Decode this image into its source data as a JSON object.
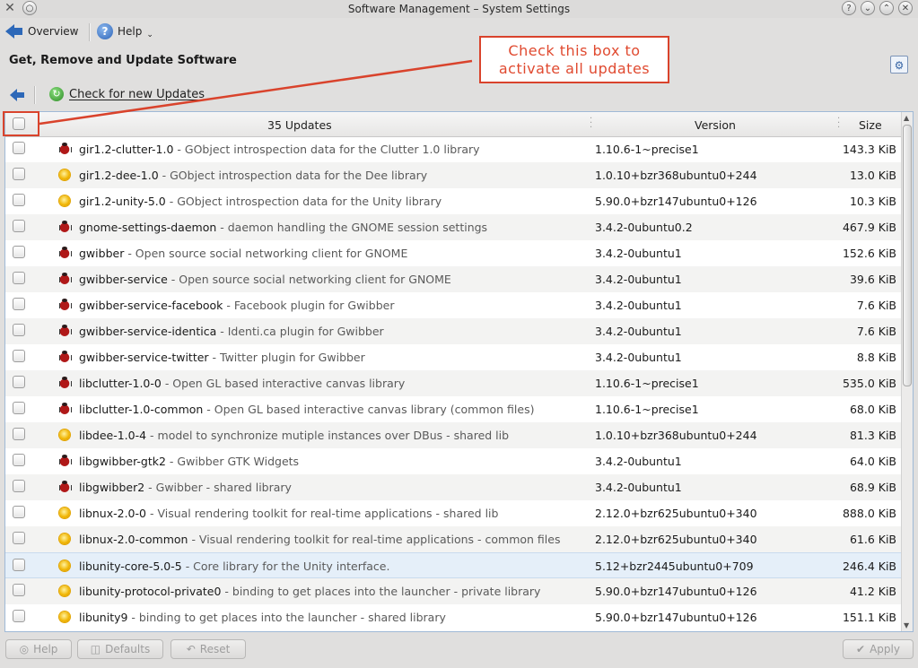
{
  "window": {
    "title": "Software Management – System Settings",
    "controls": [
      "?",
      "⌄",
      "⌃",
      "✕"
    ]
  },
  "toolbar": {
    "overview_label": "Overview",
    "help_label": "Help",
    "help_icon": "?"
  },
  "page": {
    "heading": "Get, Remove and Update Software",
    "check_updates_label": "Check for new Updates"
  },
  "annotation": {
    "text_line1": "Check this box to",
    "text_line2": "activate all updates",
    "color": "#d9432c"
  },
  "table": {
    "headers": {
      "updates": "35 Updates",
      "version": "Version",
      "size": "Size"
    },
    "rows": [
      {
        "icon": "bug",
        "name": "gir1.2-clutter-1.0",
        "desc": " - GObject introspection data for the Clutter 1.0 library",
        "version": "1.10.6-1~precise1",
        "size": "143.3 KiB"
      },
      {
        "icon": "sun",
        "name": "gir1.2-dee-1.0",
        "desc": " - GObject introspection data for the Dee library",
        "version": "1.0.10+bzr368ubuntu0+244",
        "size": "13.0 KiB"
      },
      {
        "icon": "sun",
        "name": "gir1.2-unity-5.0",
        "desc": " - GObject introspection data for the Unity library",
        "version": "5.90.0+bzr147ubuntu0+126",
        "size": "10.3 KiB"
      },
      {
        "icon": "bug",
        "name": "gnome-settings-daemon",
        "desc": " - daemon handling the GNOME session settings",
        "version": "3.4.2-0ubuntu0.2",
        "size": "467.9 KiB"
      },
      {
        "icon": "bug",
        "name": "gwibber",
        "desc": " - Open source social networking client for GNOME",
        "version": "3.4.2-0ubuntu1",
        "size": "152.6 KiB"
      },
      {
        "icon": "bug",
        "name": "gwibber-service",
        "desc": " - Open source social networking client for GNOME",
        "version": "3.4.2-0ubuntu1",
        "size": "39.6 KiB"
      },
      {
        "icon": "bug",
        "name": "gwibber-service-facebook",
        "desc": " - Facebook plugin for Gwibber",
        "version": "3.4.2-0ubuntu1",
        "size": "7.6 KiB"
      },
      {
        "icon": "bug",
        "name": "gwibber-service-identica",
        "desc": " - Identi.ca plugin for Gwibber",
        "version": "3.4.2-0ubuntu1",
        "size": "7.6 KiB"
      },
      {
        "icon": "bug",
        "name": "gwibber-service-twitter",
        "desc": " - Twitter plugin for Gwibber",
        "version": "3.4.2-0ubuntu1",
        "size": "8.8 KiB"
      },
      {
        "icon": "bug",
        "name": "libclutter-1.0-0",
        "desc": " - Open GL based interactive canvas library",
        "version": "1.10.6-1~precise1",
        "size": "535.0 KiB"
      },
      {
        "icon": "bug",
        "name": "libclutter-1.0-common",
        "desc": " - Open GL based interactive canvas library (common files)",
        "version": "1.10.6-1~precise1",
        "size": "68.0 KiB"
      },
      {
        "icon": "sun",
        "name": "libdee-1.0-4",
        "desc": " - model to synchronize mutiple instances over DBus - shared lib",
        "version": "1.0.10+bzr368ubuntu0+244",
        "size": "81.3 KiB"
      },
      {
        "icon": "bug",
        "name": "libgwibber-gtk2",
        "desc": " - Gwibber GTK Widgets",
        "version": "3.4.2-0ubuntu1",
        "size": "64.0 KiB"
      },
      {
        "icon": "bug",
        "name": "libgwibber2",
        "desc": " - Gwibber - shared library",
        "version": "3.4.2-0ubuntu1",
        "size": "68.9 KiB"
      },
      {
        "icon": "sun",
        "name": "libnux-2.0-0",
        "desc": " - Visual rendering toolkit for real-time applications - shared lib",
        "version": "2.12.0+bzr625ubuntu0+340",
        "size": "888.0 KiB"
      },
      {
        "icon": "sun",
        "name": "libnux-2.0-common",
        "desc": " - Visual rendering toolkit for real-time applications - common files",
        "version": "2.12.0+bzr625ubuntu0+340",
        "size": "61.6 KiB"
      },
      {
        "icon": "sun",
        "name": "libunity-core-5.0-5",
        "desc": " - Core library for the Unity interface.",
        "version": "5.12+bzr2445ubuntu0+709",
        "size": "246.4 KiB",
        "selected": true
      },
      {
        "icon": "sun",
        "name": "libunity-protocol-private0",
        "desc": " - binding to get places into the launcher - private library",
        "version": "5.90.0+bzr147ubuntu0+126",
        "size": "41.2 KiB"
      },
      {
        "icon": "sun",
        "name": "libunity9",
        "desc": " - binding to get places into the launcher - shared library",
        "version": "5.90.0+bzr147ubuntu0+126",
        "size": "151.1 KiB"
      }
    ]
  },
  "footer": {
    "help_label": "Help",
    "defaults_label": "Defaults",
    "reset_label": "Reset",
    "apply_label": "Apply"
  }
}
